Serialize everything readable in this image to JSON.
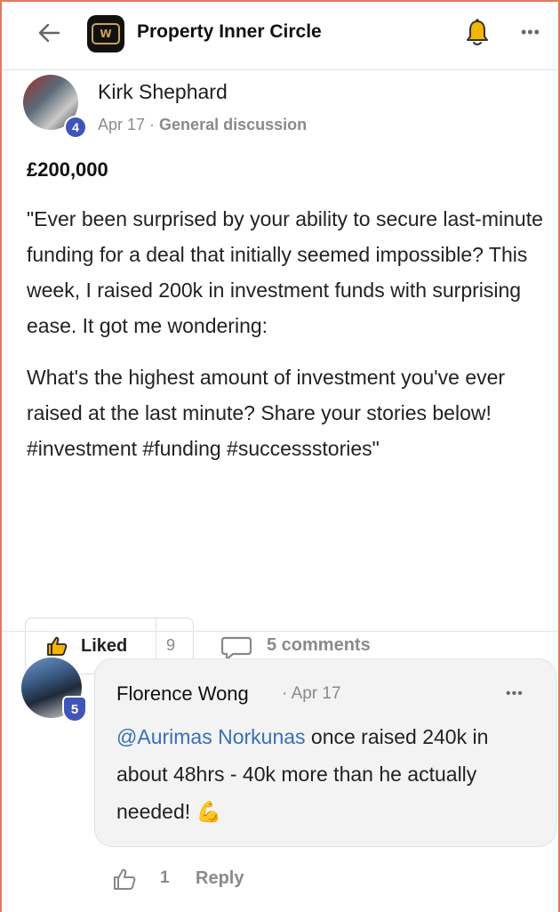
{
  "header": {
    "title": "Property Inner Circle",
    "logo_text": "W"
  },
  "post": {
    "author": "Kirk Shephard",
    "level": "4",
    "date": "Apr 17",
    "separator": " · ",
    "category": "General discussion",
    "headline": "£200,000",
    "paragraph1": "\"Ever been surprised by your ability to secure last-minute funding for a deal that initially seemed impossible? This week, I raised 200k in investment funds with surprising ease. It got me wondering:",
    "paragraph2": "What's the highest amount of investment you've ever raised at the last minute? Share your stories below! #investment #funding #successstories\"",
    "like_label": "Liked",
    "like_count": "9",
    "comments_label": "5 comments"
  },
  "comment": {
    "author": "Florence Wong",
    "level": "5",
    "date_sep": " · ",
    "date": "Apr 17",
    "mention": "@Aurimas Norkunas",
    "text": " once raised 240k in about 48hrs - 40k more than he actually needed! ",
    "emoji": "💪",
    "like_count": "1",
    "reply_label": "Reply"
  },
  "colors": {
    "accent": "#3f55b7",
    "mention": "#3a6fb5",
    "bell": "#f2b705",
    "border": "#e07b5a"
  }
}
